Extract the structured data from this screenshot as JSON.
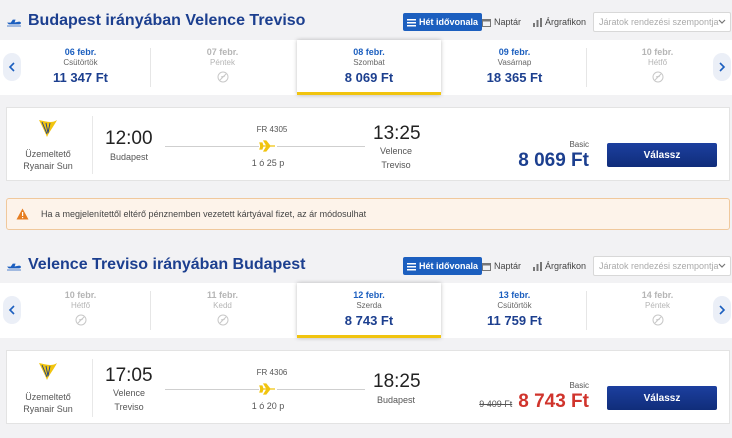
{
  "colors": {
    "accent": "#1c5fbf",
    "title": "#1c3f8f",
    "highlight": "#f1c40f",
    "discount": "#d0342c"
  },
  "view_options": {
    "week": "Hét idővonala",
    "calendar": "Naptár",
    "graph": "Árgrafikon"
  },
  "sort_placeholder": "Járatok rendezési szempontja",
  "outbound": {
    "title": "Budapest irányában Velence Treviso",
    "dates": [
      {
        "date": "06 febr.",
        "weekday": "Csütörtök",
        "price": "11 347 Ft",
        "available": true
      },
      {
        "date": "07 febr.",
        "weekday": "Péntek",
        "price": "",
        "available": false
      },
      {
        "date": "08 febr.",
        "weekday": "Szombat",
        "price": "8 069 Ft",
        "available": true,
        "selected": true
      },
      {
        "date": "09 febr.",
        "weekday": "Vasárnap",
        "price": "18 365 Ft",
        "available": true
      },
      {
        "date": "10 febr.",
        "weekday": "Hétfő",
        "price": "",
        "available": false
      }
    ],
    "flight": {
      "operator_label": "Üzemeltető",
      "operator": "Ryanair Sun",
      "depart_time": "12:00",
      "depart_city": "Budapest",
      "flight_no": "FR 4305",
      "duration": "1 ó 25 p",
      "arrive_time": "13:25",
      "arrive_city_1": "Velence",
      "arrive_city_2": "Treviso",
      "fare": "Basic",
      "old_price": "",
      "price": "8 069 Ft",
      "select_label": "Válassz"
    }
  },
  "alert": {
    "message": "Ha a megjelenítettől eltérő pénznemben vezetett kártyával fizet, az ár módosulhat"
  },
  "inbound": {
    "title": "Velence Treviso irányában Budapest",
    "dates": [
      {
        "date": "10 febr.",
        "weekday": "Hétfő",
        "price": "",
        "available": false
      },
      {
        "date": "11 febr.",
        "weekday": "Kedd",
        "price": "",
        "available": false
      },
      {
        "date": "12 febr.",
        "weekday": "Szerda",
        "price": "8 743 Ft",
        "available": true,
        "selected": true
      },
      {
        "date": "13 febr.",
        "weekday": "Csütörtök",
        "price": "11 759 Ft",
        "available": true
      },
      {
        "date": "14 febr.",
        "weekday": "Péntek",
        "price": "",
        "available": false
      }
    ],
    "flight": {
      "operator_label": "Üzemeltető",
      "operator": "Ryanair Sun",
      "depart_time": "17:05",
      "depart_city_1": "Velence",
      "depart_city_2": "Treviso",
      "flight_no": "FR 4306",
      "duration": "1 ó 20 p",
      "arrive_time": "18:25",
      "arrive_city": "Budapest",
      "fare": "Basic",
      "old_price": "9 409 Ft",
      "price": "8 743 Ft",
      "select_label": "Válassz"
    }
  }
}
